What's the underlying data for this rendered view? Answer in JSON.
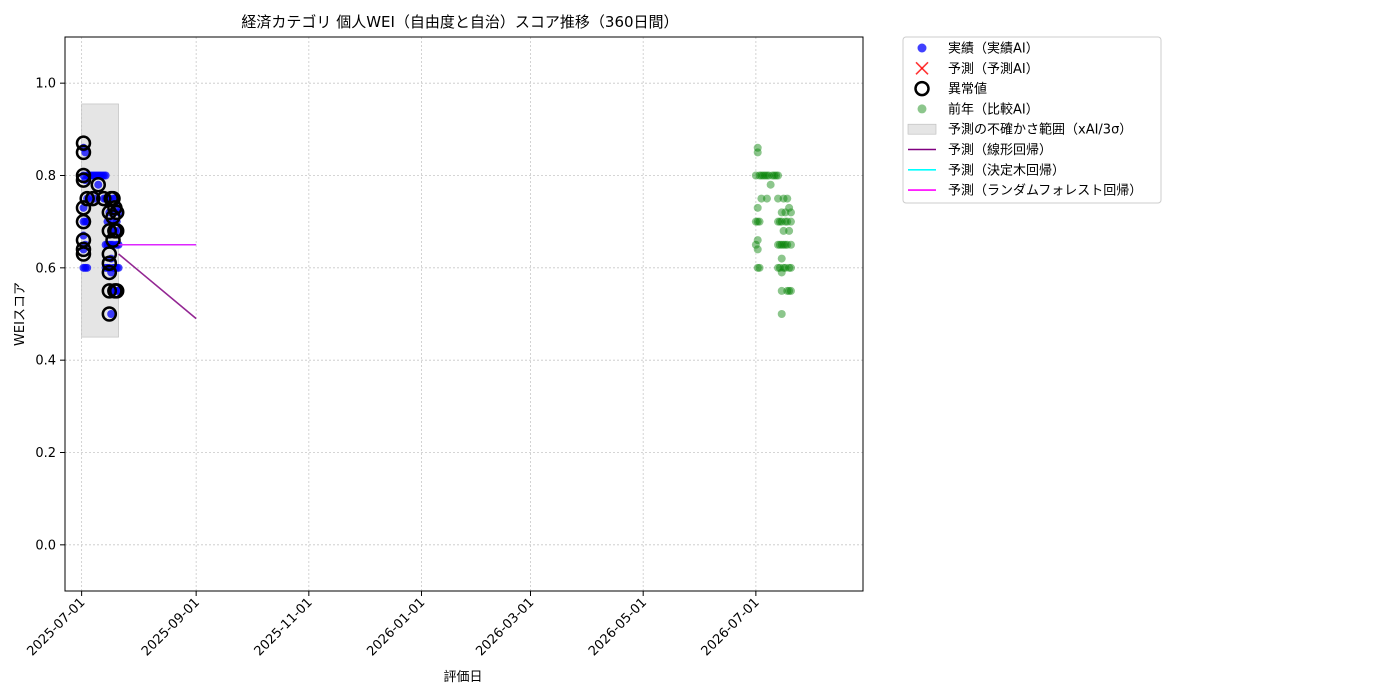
{
  "chart_data": {
    "type": "scatter",
    "title": "経済カテゴリ 個人WEI（自由度と自治）スコア推移（360日間）",
    "xlabel": "評価日",
    "ylabel": "WEIスコア",
    "x_ticks": [
      "2025-07-01",
      "2025-09-01",
      "2025-11-01",
      "2026-01-01",
      "2026-03-01",
      "2026-05-01",
      "2026-07-01"
    ],
    "y_ticks": [
      "0.0",
      "0.2",
      "0.4",
      "0.6",
      "0.8",
      "1.0"
    ],
    "xlim": [
      "2025-06-22",
      "2026-08-28"
    ],
    "ylim": [
      -0.1,
      1.1
    ],
    "grid": true,
    "legend_position": "outside-right",
    "colors": {
      "actual": "#0000ff",
      "predicted": "#ff0000",
      "anomaly": "#000000",
      "previous_year": "#008000",
      "uncertainty_band": "#d3d3d3",
      "linear_regression": "#800080",
      "decision_tree": "#00ffff",
      "random_forest": "#ff00ff"
    },
    "legend": [
      {
        "key": "actual",
        "label": "実績（実績AI）",
        "marker": "dot"
      },
      {
        "key": "predicted",
        "label": "予測（予測AI）",
        "marker": "x"
      },
      {
        "key": "anomaly",
        "label": "異常値",
        "marker": "ring"
      },
      {
        "key": "previous_year",
        "label": "前年（比較AI）",
        "marker": "dot-faint"
      },
      {
        "key": "uncertainty_band",
        "label": "予測の不確かさ範囲（xAI/3σ）",
        "marker": "patch"
      },
      {
        "key": "linear_regression",
        "label": "予測（線形回帰）",
        "marker": "line"
      },
      {
        "key": "decision_tree",
        "label": "予測（決定木回帰）",
        "marker": "line"
      },
      {
        "key": "random_forest",
        "label": "予測（ランダムフォレスト回帰）",
        "marker": "line"
      }
    ],
    "series": [
      {
        "name": "実績（実績AI）",
        "type": "scatter",
        "points": [
          [
            "2025-07-02",
            0.86
          ],
          [
            "2025-07-02",
            0.8
          ],
          [
            "2025-07-02",
            0.73
          ],
          [
            "2025-07-02",
            0.7
          ],
          [
            "2025-07-02",
            0.67
          ],
          [
            "2025-07-02",
            0.64
          ],
          [
            "2025-07-02",
            0.6
          ],
          [
            "2025-07-03",
            0.85
          ],
          [
            "2025-07-03",
            0.79
          ],
          [
            "2025-07-03",
            0.7
          ],
          [
            "2025-07-03",
            0.65
          ],
          [
            "2025-07-03",
            0.6
          ],
          [
            "2025-07-04",
            0.8
          ],
          [
            "2025-07-04",
            0.75
          ],
          [
            "2025-07-04",
            0.7
          ],
          [
            "2025-07-04",
            0.6
          ],
          [
            "2025-07-05",
            0.8
          ],
          [
            "2025-07-05",
            0.75
          ],
          [
            "2025-07-06",
            0.8
          ],
          [
            "2025-07-07",
            0.8
          ],
          [
            "2025-07-08",
            0.75
          ],
          [
            "2025-07-08",
            0.8
          ],
          [
            "2025-07-09",
            0.8
          ],
          [
            "2025-07-10",
            0.78
          ],
          [
            "2025-07-10",
            0.8
          ],
          [
            "2025-07-11",
            0.8
          ],
          [
            "2025-07-12",
            0.8
          ],
          [
            "2025-07-13",
            0.75
          ],
          [
            "2025-07-13",
            0.8
          ],
          [
            "2025-07-14",
            0.8
          ],
          [
            "2025-07-14",
            0.65
          ],
          [
            "2025-07-14",
            0.6
          ],
          [
            "2025-07-14",
            0.75
          ],
          [
            "2025-07-15",
            0.7
          ],
          [
            "2025-07-15",
            0.65
          ],
          [
            "2025-07-15",
            0.6
          ],
          [
            "2025-07-16",
            0.72
          ],
          [
            "2025-07-16",
            0.65
          ],
          [
            "2025-07-16",
            0.6
          ],
          [
            "2025-07-16",
            0.75
          ],
          [
            "2025-07-17",
            0.68
          ],
          [
            "2025-07-17",
            0.62
          ],
          [
            "2025-07-17",
            0.59
          ],
          [
            "2025-07-17",
            0.55
          ],
          [
            "2025-07-17",
            0.5
          ],
          [
            "2025-07-17",
            0.65
          ],
          [
            "2025-07-18",
            0.75
          ],
          [
            "2025-07-18",
            0.72
          ],
          [
            "2025-07-18",
            0.7
          ],
          [
            "2025-07-18",
            0.65
          ],
          [
            "2025-07-18",
            0.6
          ],
          [
            "2025-07-19",
            0.75
          ],
          [
            "2025-07-19",
            0.68
          ],
          [
            "2025-07-19",
            0.6
          ],
          [
            "2025-07-19",
            0.55
          ],
          [
            "2025-07-20",
            0.73
          ],
          [
            "2025-07-20",
            0.7
          ],
          [
            "2025-07-20",
            0.65
          ],
          [
            "2025-07-20",
            0.6
          ],
          [
            "2025-07-20",
            0.55
          ],
          [
            "2025-07-21",
            0.72
          ],
          [
            "2025-07-21",
            0.68
          ],
          [
            "2025-07-21",
            0.65
          ],
          [
            "2025-07-21",
            0.6
          ],
          [
            "2025-07-21",
            0.55
          ]
        ]
      },
      {
        "name": "異常値",
        "type": "scatter",
        "points": [
          [
            "2025-07-02",
            0.87
          ],
          [
            "2025-07-02",
            0.85
          ],
          [
            "2025-07-02",
            0.8
          ],
          [
            "2025-07-02",
            0.79
          ],
          [
            "2025-07-02",
            0.73
          ],
          [
            "2025-07-02",
            0.7
          ],
          [
            "2025-07-02",
            0.66
          ],
          [
            "2025-07-02",
            0.64
          ],
          [
            "2025-07-02",
            0.63
          ],
          [
            "2025-07-04",
            0.75
          ],
          [
            "2025-07-07",
            0.75
          ],
          [
            "2025-07-10",
            0.78
          ],
          [
            "2025-07-13",
            0.75
          ],
          [
            "2025-07-16",
            0.72
          ],
          [
            "2025-07-16",
            0.68
          ],
          [
            "2025-07-16",
            0.63
          ],
          [
            "2025-07-16",
            0.61
          ],
          [
            "2025-07-16",
            0.59
          ],
          [
            "2025-07-16",
            0.55
          ],
          [
            "2025-07-16",
            0.5
          ],
          [
            "2025-07-17",
            0.75
          ],
          [
            "2025-07-18",
            0.75
          ],
          [
            "2025-07-18",
            0.71
          ],
          [
            "2025-07-18",
            0.66
          ],
          [
            "2025-07-19",
            0.73
          ],
          [
            "2025-07-19",
            0.68
          ],
          [
            "2025-07-19",
            0.55
          ],
          [
            "2025-07-20",
            0.72
          ],
          [
            "2025-07-20",
            0.68
          ],
          [
            "2025-07-20",
            0.55
          ]
        ]
      },
      {
        "name": "前年（比較AI）",
        "type": "scatter",
        "points": [
          [
            "2026-07-01",
            0.8
          ],
          [
            "2026-07-01",
            0.7
          ],
          [
            "2026-07-01",
            0.65
          ],
          [
            "2026-07-02",
            0.86
          ],
          [
            "2026-07-02",
            0.85
          ],
          [
            "2026-07-02",
            0.73
          ],
          [
            "2026-07-02",
            0.7
          ],
          [
            "2026-07-02",
            0.66
          ],
          [
            "2026-07-02",
            0.64
          ],
          [
            "2026-07-02",
            0.6
          ],
          [
            "2026-07-03",
            0.8
          ],
          [
            "2026-07-03",
            0.7
          ],
          [
            "2026-07-03",
            0.6
          ],
          [
            "2026-07-04",
            0.8
          ],
          [
            "2026-07-04",
            0.75
          ],
          [
            "2026-07-05",
            0.8
          ],
          [
            "2026-07-06",
            0.8
          ],
          [
            "2026-07-07",
            0.8
          ],
          [
            "2026-07-07",
            0.75
          ],
          [
            "2026-07-08",
            0.8
          ],
          [
            "2026-07-09",
            0.78
          ],
          [
            "2026-07-10",
            0.8
          ],
          [
            "2026-07-11",
            0.8
          ],
          [
            "2026-07-12",
            0.8
          ],
          [
            "2026-07-13",
            0.8
          ],
          [
            "2026-07-13",
            0.75
          ],
          [
            "2026-07-13",
            0.7
          ],
          [
            "2026-07-13",
            0.65
          ],
          [
            "2026-07-13",
            0.6
          ],
          [
            "2026-07-14",
            0.7
          ],
          [
            "2026-07-14",
            0.65
          ],
          [
            "2026-07-14",
            0.6
          ],
          [
            "2026-07-15",
            0.72
          ],
          [
            "2026-07-15",
            0.7
          ],
          [
            "2026-07-15",
            0.65
          ],
          [
            "2026-07-15",
            0.62
          ],
          [
            "2026-07-15",
            0.59
          ],
          [
            "2026-07-15",
            0.55
          ],
          [
            "2026-07-15",
            0.5
          ],
          [
            "2026-07-16",
            0.75
          ],
          [
            "2026-07-16",
            0.68
          ],
          [
            "2026-07-16",
            0.65
          ],
          [
            "2026-07-16",
            0.6
          ],
          [
            "2026-07-17",
            0.72
          ],
          [
            "2026-07-17",
            0.7
          ],
          [
            "2026-07-17",
            0.65
          ],
          [
            "2026-07-17",
            0.6
          ],
          [
            "2026-07-18",
            0.75
          ],
          [
            "2026-07-18",
            0.7
          ],
          [
            "2026-07-18",
            0.65
          ],
          [
            "2026-07-18",
            0.55
          ],
          [
            "2026-07-19",
            0.73
          ],
          [
            "2026-07-19",
            0.68
          ],
          [
            "2026-07-19",
            0.6
          ],
          [
            "2026-07-19",
            0.55
          ],
          [
            "2026-07-20",
            0.72
          ],
          [
            "2026-07-20",
            0.7
          ],
          [
            "2026-07-20",
            0.65
          ],
          [
            "2026-07-20",
            0.6
          ],
          [
            "2026-07-20",
            0.55
          ]
        ]
      },
      {
        "name": "予測の不確かさ範囲（xAI/3σ）",
        "type": "band",
        "x": [
          "2025-07-01",
          "2025-07-21"
        ],
        "y": [
          0.45,
          0.955
        ]
      },
      {
        "name": "予測（線形回帰）",
        "type": "line",
        "points": [
          [
            "2025-07-21",
            0.63
          ],
          [
            "2025-09-01",
            0.49
          ]
        ]
      },
      {
        "name": "予測（決定木回帰）",
        "type": "line",
        "points": [
          [
            "2025-07-21",
            0.65
          ],
          [
            "2025-09-01",
            0.65
          ]
        ]
      },
      {
        "name": "予測（ランダムフォレスト回帰）",
        "type": "line",
        "points": [
          [
            "2025-07-21",
            0.65
          ],
          [
            "2025-09-01",
            0.65
          ]
        ]
      }
    ]
  }
}
